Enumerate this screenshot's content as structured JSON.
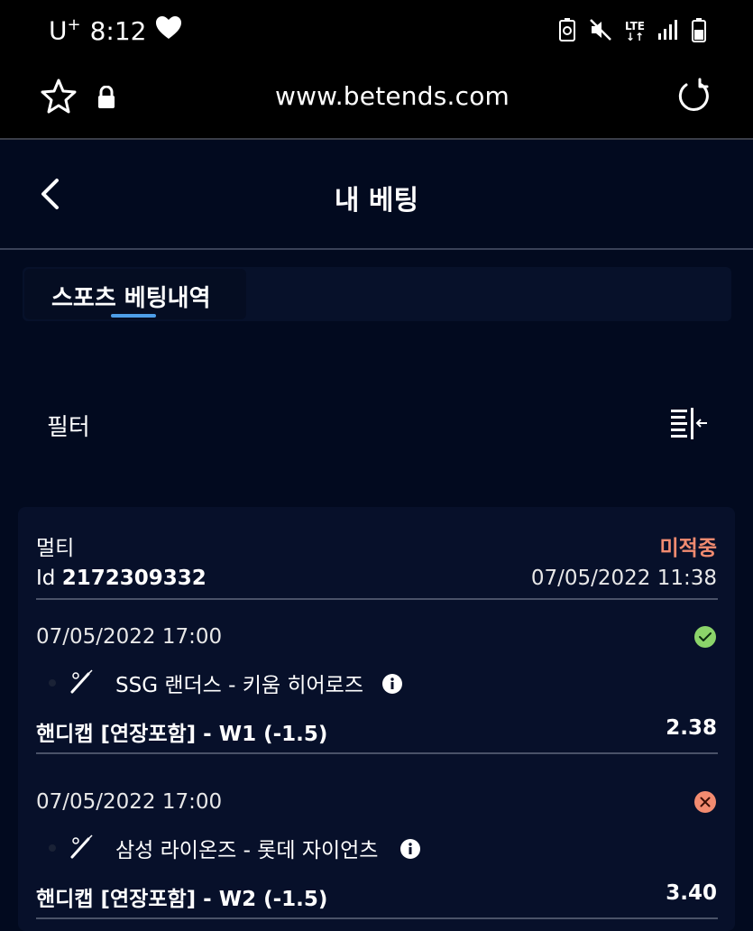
{
  "status_bar": {
    "carrier": "U",
    "carrier_sup": "+",
    "time": "8:12",
    "network": "LTE"
  },
  "browser": {
    "url": "www.betends.com"
  },
  "header": {
    "title": "내 베팅"
  },
  "tabs": [
    {
      "label": "스포츠 베팅내역",
      "active": true
    }
  ],
  "filter": {
    "label": "필터"
  },
  "bet": {
    "type": "멀티",
    "status": "미적중",
    "id_prefix": "Id",
    "id": "2172309332",
    "placed": "07/05/2022 11:38",
    "selections": [
      {
        "time": "07/05/2022 17:00",
        "result": "won",
        "match": "SSG 랜더스 - 키움 히어로즈",
        "market": "핸디캡 [연장포함] - W1 (-1.5)",
        "odds": "2.38"
      },
      {
        "time": "07/05/2022 17:00",
        "result": "lost",
        "match": "삼성 라이온즈 - 롯데 자이언츠",
        "market": "핸디캡 [연장포함] - W2 (-1.5)",
        "odds": "3.40"
      }
    ]
  },
  "colors": {
    "background": "#020a1f",
    "accent": "#4d9ee8",
    "lost": "#f28b70",
    "won": "#8bd46a"
  }
}
